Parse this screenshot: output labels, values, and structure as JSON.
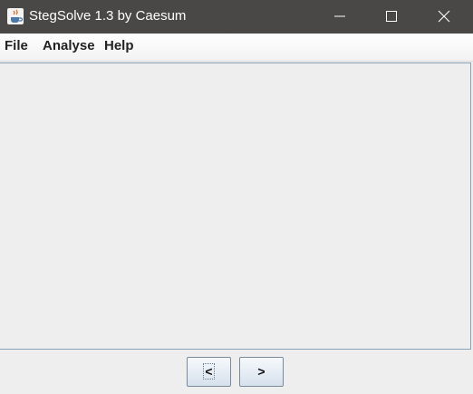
{
  "window": {
    "title": "StegSolve 1.3 by Caesum",
    "controls": {
      "minimize_icon": "minimize-icon",
      "maximize_icon": "maximize-icon",
      "close_icon": "close-icon"
    },
    "app_icon": "java-cup-icon"
  },
  "menubar": {
    "items": [
      {
        "label": "File"
      },
      {
        "label": "Analyse"
      },
      {
        "label": "Help"
      }
    ]
  },
  "navigation": {
    "prev_label": "<",
    "next_label": ">"
  },
  "colors": {
    "titlebar_bg": "#4a4846",
    "panel_bg": "#eeeeee",
    "panel_border": "#8aa2b8",
    "button_border": "#7a8a9a"
  }
}
